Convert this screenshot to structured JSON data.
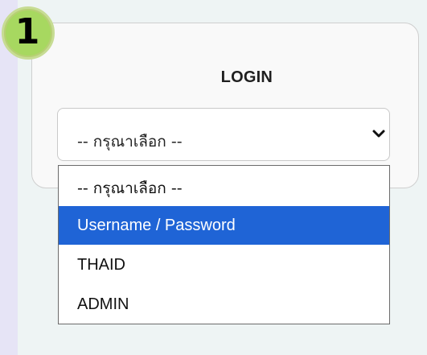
{
  "step": {
    "number": "1"
  },
  "login": {
    "title": "LOGIN",
    "select": {
      "value": "-- กรุณาเลือก --",
      "options": [
        "-- กรุณาเลือก --",
        "Username / Password",
        "THAID",
        "ADMIN"
      ],
      "highlighted_index": 1
    }
  },
  "colors": {
    "page_background": "#e6e4f6",
    "content_background": "#eef4f4",
    "badge_fill": "#a7d860",
    "highlight": "#1f64d6"
  },
  "icons": {
    "select_arrow": "chevron-down-icon"
  }
}
